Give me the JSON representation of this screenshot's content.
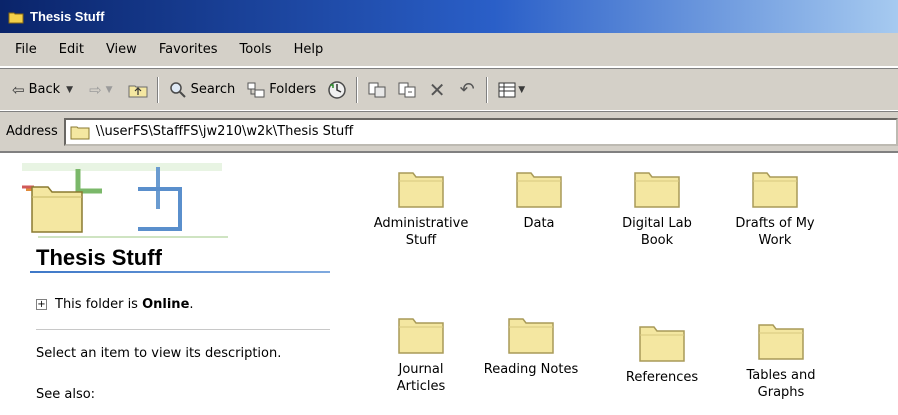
{
  "window": {
    "title": "Thesis Stuff"
  },
  "menu": {
    "items": [
      "File",
      "Edit",
      "View",
      "Favorites",
      "Tools",
      "Help"
    ]
  },
  "toolbar": {
    "back": "Back",
    "search": "Search",
    "folders": "Folders"
  },
  "address": {
    "label": "Address",
    "value": "\\\\userFS\\StaffFS\\jw210\\w2k\\Thesis Stuff"
  },
  "leftpane": {
    "title": "Thesis Stuff",
    "online_prefix": "This folder is ",
    "online_status": "Online",
    "online_suffix": ".",
    "description": "Select an item to view its description.",
    "see_also": "See also:"
  },
  "folders": [
    {
      "line1": "Administrative",
      "line2": "Stuff"
    },
    {
      "line1": "Data",
      "line2": ""
    },
    {
      "line1": "Digital Lab",
      "line2": "Book"
    },
    {
      "line1": "Drafts of My",
      "line2": "Work"
    },
    {
      "line1": "Journal",
      "line2": "Articles"
    },
    {
      "line1": "Reading Notes",
      "line2": ""
    },
    {
      "line1": "References",
      "line2": ""
    },
    {
      "line1": "Tables and",
      "line2": "Graphs"
    }
  ],
  "colors": {
    "titlebar": "#0a246a",
    "chrome": "#d4d0c8",
    "folder": "#f4e7a1",
    "accent": "#3e78c8"
  },
  "icons": [
    "folder-icon",
    "back-arrow-icon",
    "forward-arrow-icon",
    "up-folder-icon",
    "search-icon",
    "folders-tree-icon",
    "history-icon",
    "move-to-icon",
    "copy-to-icon",
    "delete-icon",
    "undo-icon",
    "views-icon"
  ]
}
